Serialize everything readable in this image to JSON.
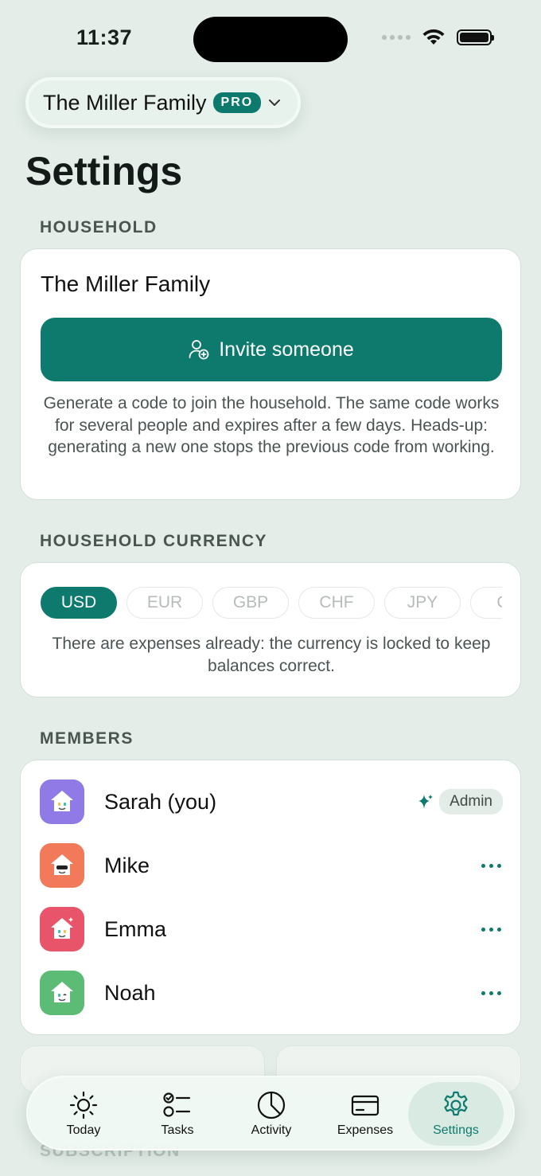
{
  "status": {
    "time": "11:37"
  },
  "switcher": {
    "name": "The Miller Family",
    "badge": "PRO"
  },
  "page": {
    "title": "Settings"
  },
  "household": {
    "section_label": "HOUSEHOLD",
    "name": "The Miller Family",
    "invite_label": "Invite someone",
    "help_text": "Generate a code to join the household. The same code works for several people and expires after a few days. Heads-up: generating a new one stops the previous code from working."
  },
  "currency": {
    "section_label": "HOUSEHOLD CURRENCY",
    "options": [
      "USD",
      "EUR",
      "GBP",
      "CHF",
      "JPY",
      "CA"
    ],
    "selected": "USD",
    "note": "There are expenses already: the currency is locked to keep balances correct."
  },
  "members": {
    "section_label": "MEMBERS",
    "items": [
      {
        "name": "Sarah (you)",
        "role": "Admin",
        "color": "#8f7ae6"
      },
      {
        "name": "Mike",
        "color": "#f27a5a"
      },
      {
        "name": "Emma",
        "color": "#e8546a"
      },
      {
        "name": "Noah",
        "color": "#5cbb74"
      }
    ]
  },
  "bottom_sections": {
    "subscription_label": "SUBSCRIPTION"
  },
  "tabs": [
    {
      "label": "Today",
      "icon": "sun-icon"
    },
    {
      "label": "Tasks",
      "icon": "checklist-icon"
    },
    {
      "label": "Activity",
      "icon": "pie-chart-icon"
    },
    {
      "label": "Expenses",
      "icon": "card-icon"
    },
    {
      "label": "Settings",
      "icon": "gear-icon",
      "active": true
    }
  ],
  "colors": {
    "accent": "#0e7a6e",
    "background": "#e4ede8"
  }
}
